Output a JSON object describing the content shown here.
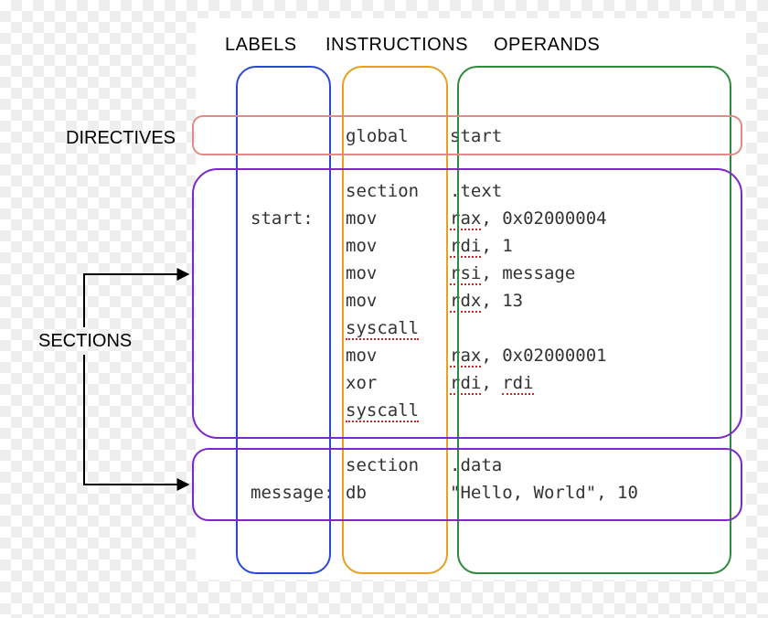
{
  "headers": {
    "labels": "LABELS",
    "instructions": "INSTRUCTIONS",
    "operands": "OPERANDS"
  },
  "sideLabels": {
    "directives": "DIRECTIVES",
    "sections": "SECTIONS"
  },
  "code": {
    "rows": [
      {
        "label": "",
        "instr": "global",
        "operand": "start"
      },
      {
        "label": "",
        "instr": "",
        "operand": ""
      },
      {
        "label": "",
        "instr": "section",
        "operand": ".text"
      },
      {
        "label": "start:",
        "instr": "mov",
        "operand_parts": [
          [
            "rax",
            true
          ],
          [
            ", 0x02000004",
            false
          ]
        ]
      },
      {
        "label": "",
        "instr": "mov",
        "operand_parts": [
          [
            "rdi",
            true
          ],
          [
            ", 1",
            false
          ]
        ]
      },
      {
        "label": "",
        "instr": "mov",
        "operand_parts": [
          [
            "rsi",
            true
          ],
          [
            ", message",
            false
          ]
        ]
      },
      {
        "label": "",
        "instr": "mov",
        "operand_parts": [
          [
            "rdx",
            true
          ],
          [
            ", 13",
            false
          ]
        ]
      },
      {
        "label": "",
        "instr": "syscall",
        "instr_dotted": true,
        "operand": ""
      },
      {
        "label": "",
        "instr": "mov",
        "operand_parts": [
          [
            "rax",
            true
          ],
          [
            ", 0x02000001",
            false
          ]
        ]
      },
      {
        "label": "",
        "instr": "xor",
        "operand_parts": [
          [
            "rdi",
            true
          ],
          [
            ", ",
            false
          ],
          [
            "rdi",
            true
          ]
        ]
      },
      {
        "label": "",
        "instr": "syscall",
        "instr_dotted": true,
        "operand": ""
      },
      {
        "label": "",
        "instr": "",
        "operand": ""
      },
      {
        "label": "",
        "instr": "section",
        "operand": ".data"
      },
      {
        "label": "message:",
        "instr": "db",
        "operand": "\"Hello, World\", 10"
      }
    ]
  },
  "colors": {
    "labels_box": "#2948d6",
    "instructions_box": "#e7a020",
    "operands_box": "#2e8b3c",
    "directives_box": "#e08a8a",
    "sections_box": "#7b27c9",
    "dotted_underline": "#c62828"
  }
}
